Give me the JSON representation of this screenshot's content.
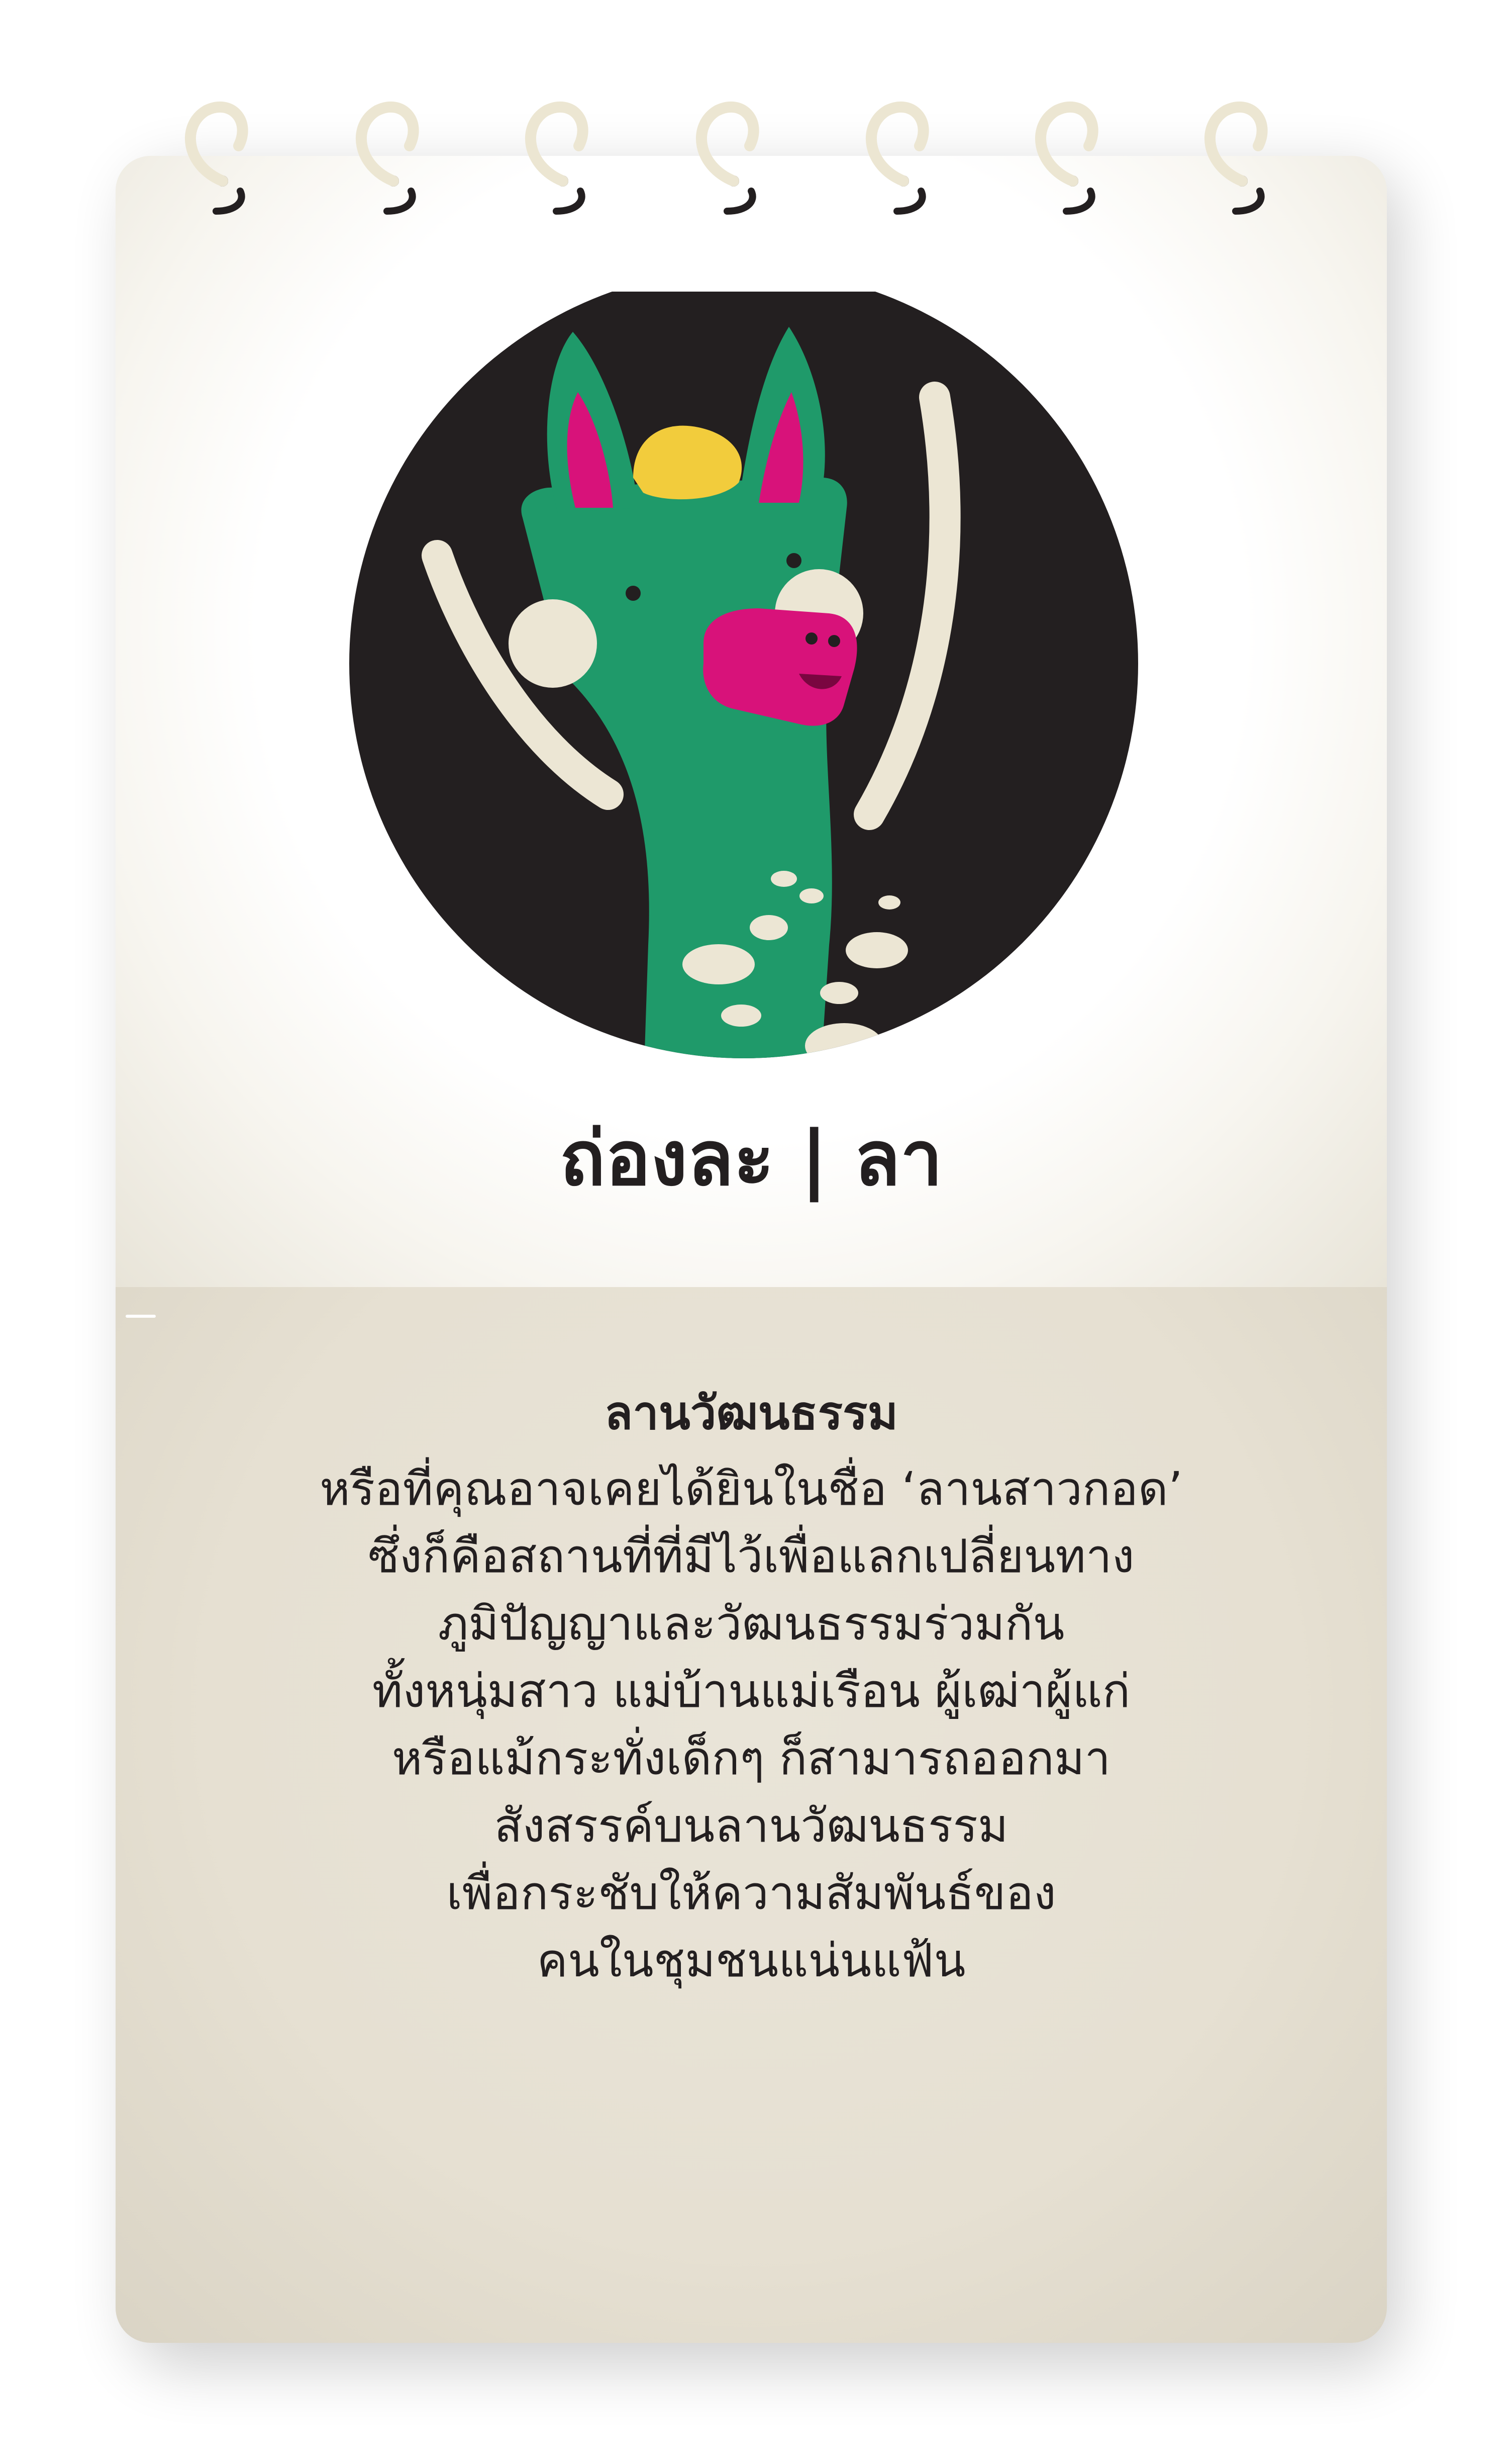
{
  "card": {
    "title": "ถ่องละ | ลา",
    "description_heading": "ลานวัฒนธรรม",
    "description_lines": [
      "หรือที่คุณอาจเคยได้ยินในชื่อ ‘ลานสาวกอด’",
      "ซึ่งก็คือสถานที่ที่มีไว้เพื่อแลกเปลี่ยนทาง",
      "ภูมิปัญญาและวัฒนธรรมร่วมกัน",
      "ทั้งหนุ่มสาว แม่บ้านแม่เรือน ผู้เฒ่าผู้แก่",
      "หรือแม้กระทั่งเด็กๆ ก็สามารถออกมา",
      "สังสรรค์บนลานวัฒนธรรม",
      "เพื่อกระชับให้ความสัมพันธ์ของ",
      "คนในชุมชนแน่นแฟ้น"
    ]
  },
  "illustration": {
    "subject": "green-monster-icon",
    "colors": {
      "circle_background": "#231f20",
      "body": "#1f9a6a",
      "ears_inner": "#d8127a",
      "snout": "#d8127a",
      "crown": "#f2cc3c",
      "arms_and_spots": "#ece6d4"
    }
  },
  "binding_rings": {
    "count": 7,
    "color": "#ece6d2",
    "hole_color": "#231f20"
  }
}
